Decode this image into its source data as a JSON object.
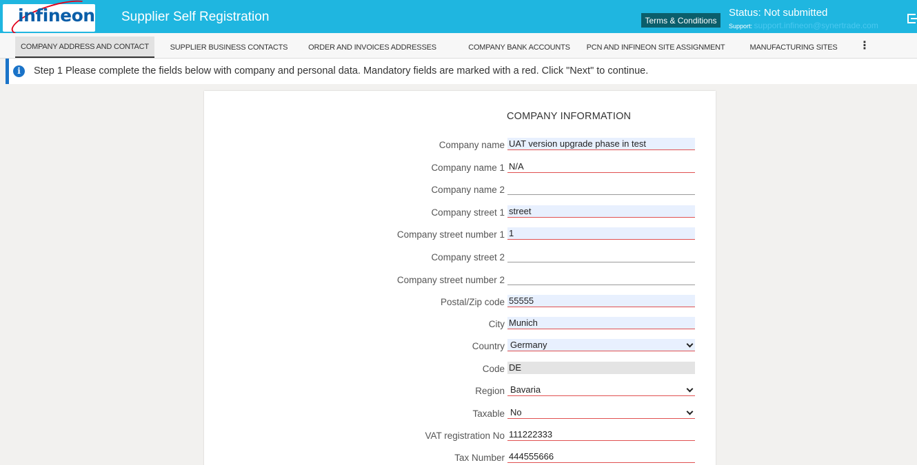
{
  "header": {
    "logo": "infineon",
    "title": "Supplier Self Registration",
    "terms_label": "Terms & Conditions",
    "status": "Status: Not submitted",
    "support_label": "Support:",
    "support_email": "support.infineon@synertrade.com"
  },
  "tabs": [
    {
      "label": "COMPANY ADDRESS AND CONTACT",
      "active": true
    },
    {
      "label": "SUPPLIER BUSINESS CONTACTS"
    },
    {
      "label": "ORDER AND INVOICES ADDRESSES"
    },
    {
      "label": "COMPANY BANK ACCOUNTS"
    },
    {
      "label": "PCN AND INFINEON SITE ASSIGNMENT"
    },
    {
      "label": "MANUFACTURING SITES"
    }
  ],
  "info": {
    "message": "Step 1 Please complete the fields below with company and personal data. Mandatory fields are marked with a red. Click \"Next\" to continue."
  },
  "form": {
    "section_title": "COMPANY INFORMATION",
    "fields": [
      {
        "label": "Company name",
        "value": "UAT version upgrade phase in test"
      },
      {
        "label": "Company name 1",
        "value": "N/A"
      },
      {
        "label": "Company name 2",
        "value": ""
      },
      {
        "label": "Company street 1",
        "value": "street"
      },
      {
        "label": "Company street number 1",
        "value": "1"
      },
      {
        "label": "Company street 2",
        "value": ""
      },
      {
        "label": "Company street number 2",
        "value": ""
      },
      {
        "label": "Postal/Zip code",
        "value": "55555"
      },
      {
        "label": "City",
        "value": "Munich"
      },
      {
        "label": "Country",
        "value": "Germany"
      },
      {
        "label": "Code",
        "value": "DE"
      },
      {
        "label": "Region",
        "value": "Bavaria"
      },
      {
        "label": "Taxable",
        "value": "No"
      },
      {
        "label": "VAT registration No",
        "value": "111222333"
      },
      {
        "label": "Tax Number",
        "value": "444555666"
      }
    ]
  },
  "colors": {
    "header_bg": "#1fb6e0",
    "brand_blue": "#0a5ea8",
    "brand_red": "#e2001a",
    "mandatory_underline": "#e05050",
    "info_accent": "#1a73c8"
  }
}
